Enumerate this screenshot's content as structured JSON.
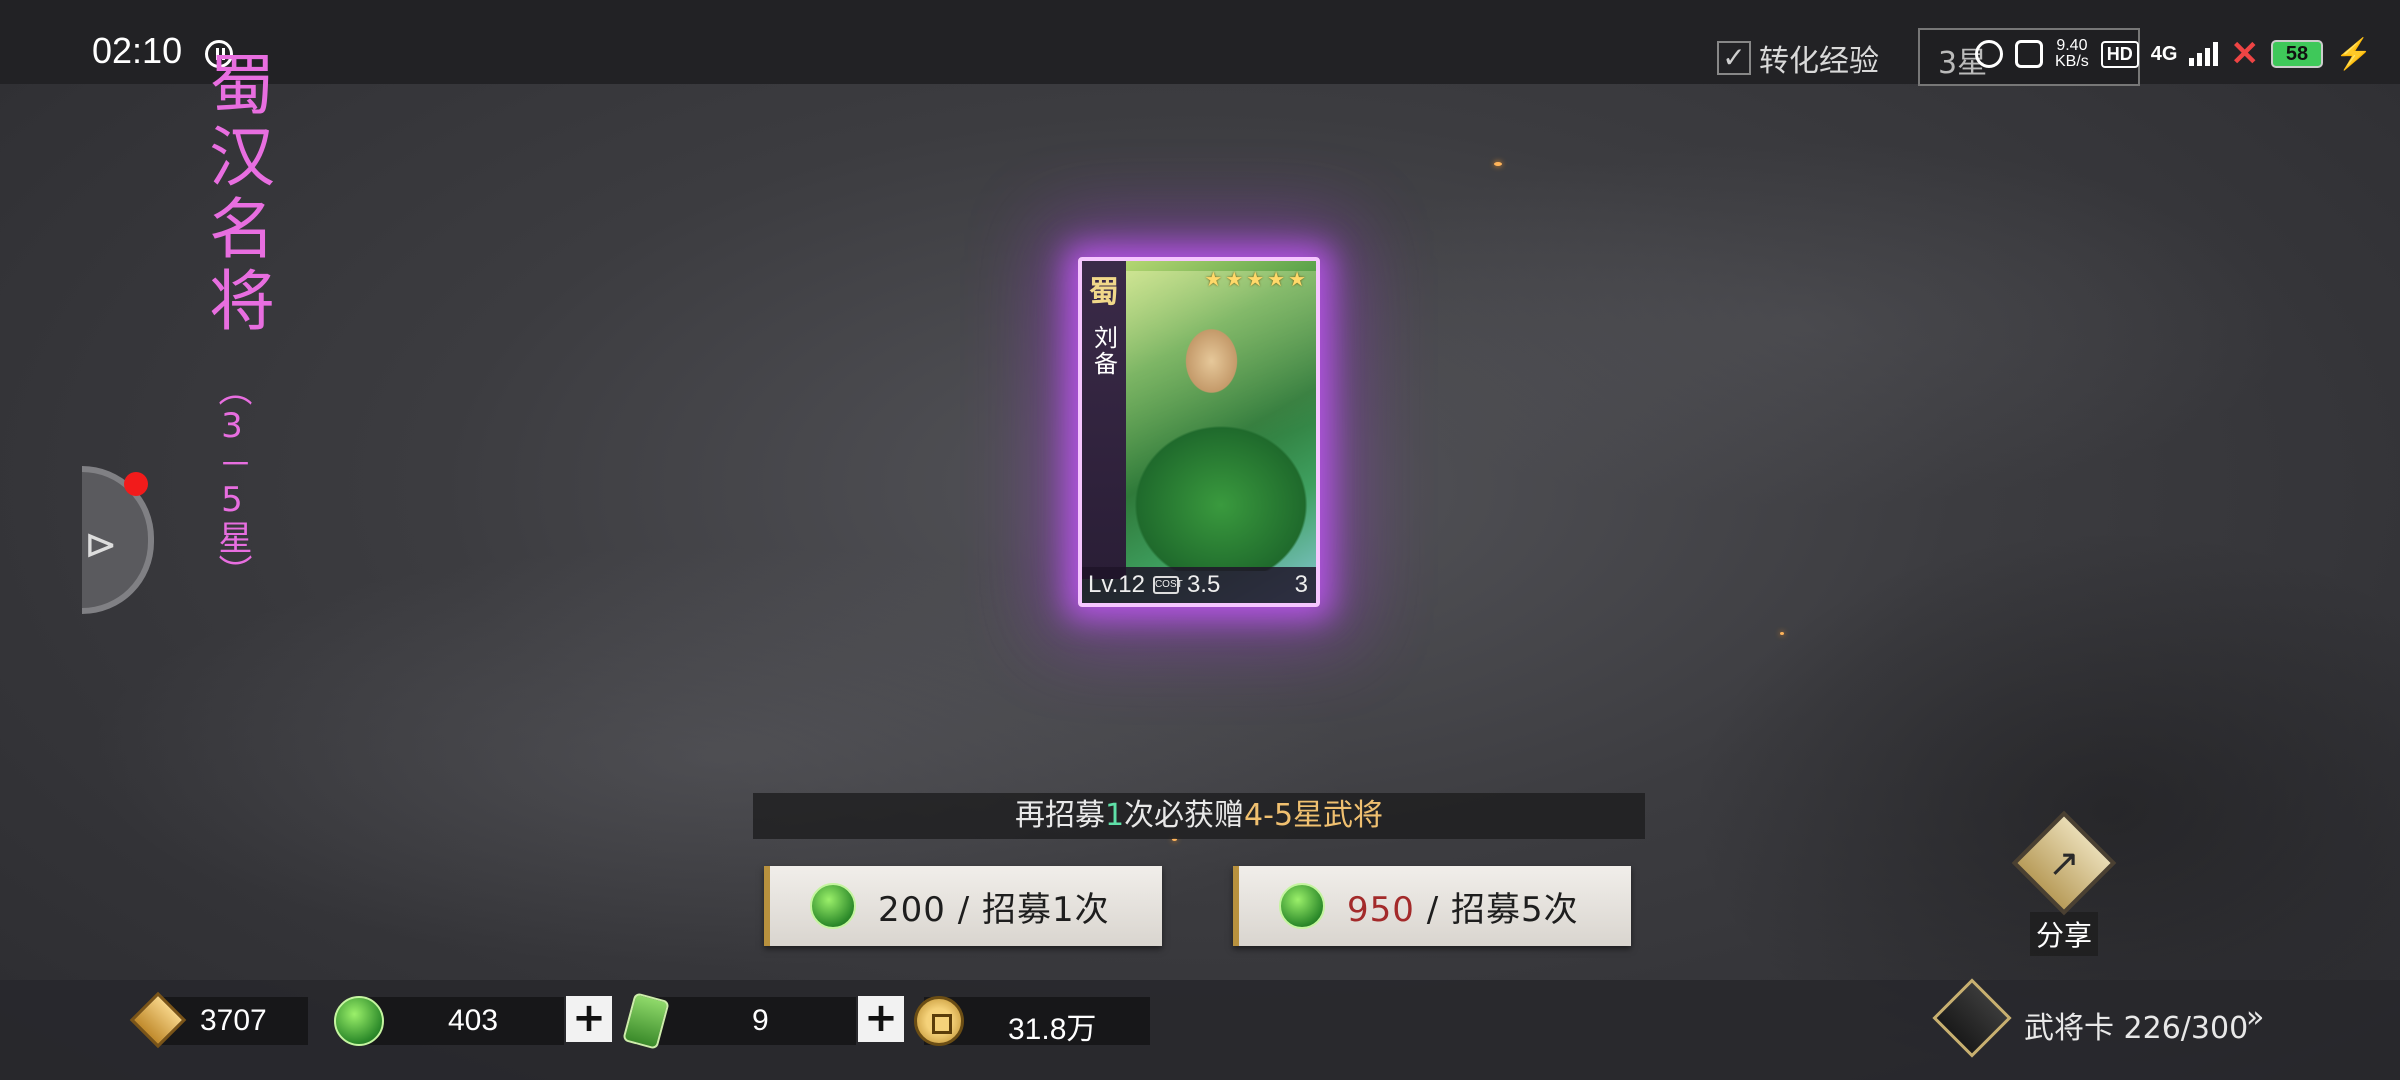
{
  "status_bar": {
    "time": "02:10",
    "net_speed_value": "9.40",
    "net_speed_unit": "KB/s",
    "hd_label": "HD",
    "network_type": "4G",
    "battery_level": "58"
  },
  "top_controls": {
    "convert_exp_label": "转化经验",
    "convert_exp_checked": true,
    "star_filter_label": "3星"
  },
  "banner": {
    "title": "蜀汉名将",
    "subtitle": "（3－5星）"
  },
  "card": {
    "faction": "蜀",
    "name": "刘备",
    "stars": 5,
    "level": "Lv.12",
    "cost_icon_label": "COST",
    "cost": "3.5",
    "count": "3"
  },
  "hint": {
    "prefix": "再招募",
    "count": "1",
    "middle": "次必获赠",
    "reward": "4-5星武将"
  },
  "buttons": {
    "recruit_once": {
      "cost": "200",
      "label": "/ 招募1次"
    },
    "recruit_five": {
      "cost": "950",
      "label": "/ 招募5次"
    }
  },
  "share": {
    "label": "分享"
  },
  "resources": {
    "merit": "3707",
    "jade": "403",
    "recruit_tokens": "9",
    "copper": "31.8万"
  },
  "general_cards": {
    "label": "武将卡 226/300",
    "chevron": "»"
  },
  "colors": {
    "title_pink": "#e86ee0",
    "card_glow": "#c85aff",
    "hint_number": "#5fe0a8",
    "hint_reward": "#f0c070",
    "cost_red": "#a32a2a"
  }
}
